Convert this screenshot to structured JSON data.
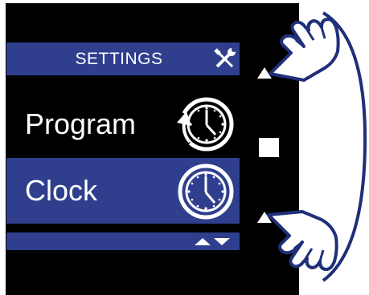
{
  "header": {
    "title": "SETTINGS",
    "icon": "wrench-screwdriver-icon"
  },
  "menu": {
    "items": [
      {
        "label": "Program",
        "icon": "clock-cycle-icon",
        "selected": false
      },
      {
        "label": "Clock",
        "icon": "clock-icon",
        "selected": true
      }
    ]
  },
  "footer": {
    "icon": "scroll-up-down-icon"
  },
  "controls": {
    "up": "up-arrow-icon",
    "select": "select-button",
    "down": "down-arrow-icon"
  },
  "colors": {
    "accent": "#2f3f8e",
    "screen_bg": "#000000",
    "text": "#ffffff"
  }
}
